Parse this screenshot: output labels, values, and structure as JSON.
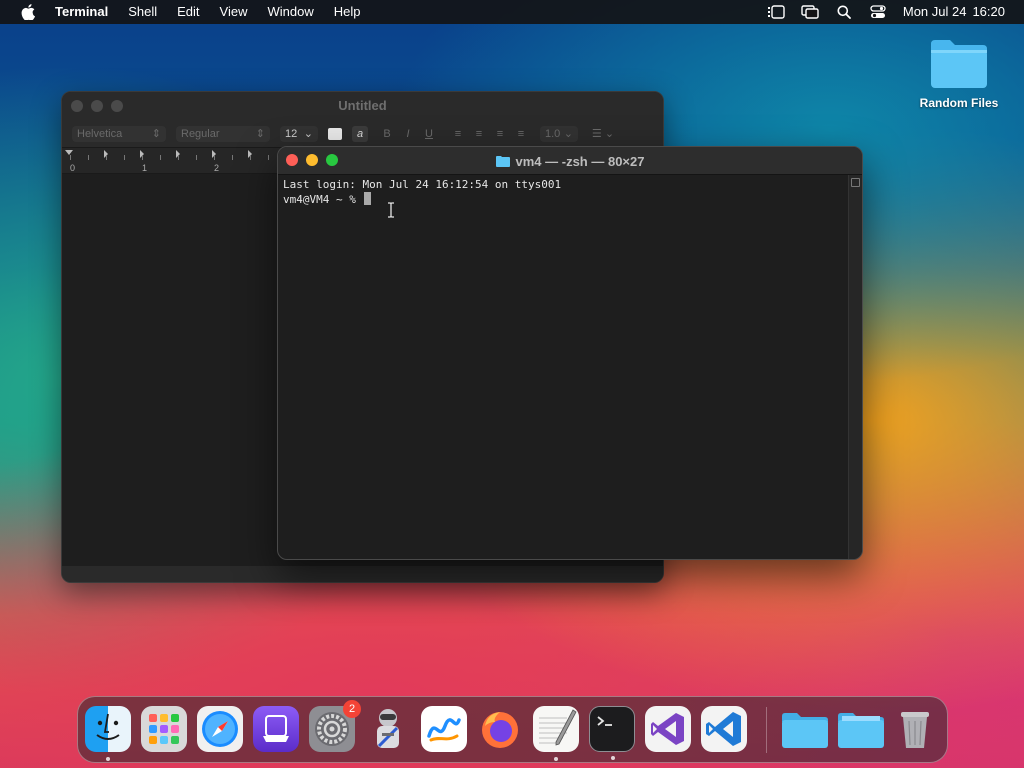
{
  "menubar": {
    "app_name": "Terminal",
    "menus": [
      "Shell",
      "Edit",
      "View",
      "Window",
      "Help"
    ],
    "date": "Mon Jul 24",
    "time": "16:20"
  },
  "desktop": {
    "icons": [
      {
        "label": "Random Files",
        "icon": "folder-icon"
      }
    ]
  },
  "textedit": {
    "title": "Untitled",
    "font_family": "Helvetica",
    "font_style": "Regular",
    "font_size": "12",
    "line_spacing": "1.0",
    "ruler_numbers": [
      "0",
      "1",
      "2"
    ],
    "format_buttons": [
      "B",
      "I",
      "U"
    ]
  },
  "terminal": {
    "title": "vm4 — -zsh — 80×27",
    "lines": [
      "Last login: Mon Jul 24 16:12:54 on ttys001",
      "vm4@VM4 ~ % "
    ]
  },
  "dock": {
    "apps": [
      {
        "name": "Finder",
        "icon": "finder-icon",
        "running": true
      },
      {
        "name": "Launchpad",
        "icon": "launchpad-icon",
        "running": false
      },
      {
        "name": "Safari",
        "icon": "safari-icon",
        "running": false
      },
      {
        "name": "Simulator",
        "icon": "simulator-icon",
        "running": false
      },
      {
        "name": "System Settings",
        "icon": "system-settings-icon",
        "running": false,
        "badge": "2"
      },
      {
        "name": "Automator",
        "icon": "automator-icon",
        "running": false
      },
      {
        "name": "Freeform",
        "icon": "freeform-icon",
        "running": false
      },
      {
        "name": "Firefox",
        "icon": "firefox-icon",
        "running": false
      },
      {
        "name": "TextEdit",
        "icon": "textedit-icon",
        "running": true
      },
      {
        "name": "Terminal",
        "icon": "terminal-icon",
        "running": true
      },
      {
        "name": "Visual Studio",
        "icon": "visual-studio-icon",
        "running": false
      },
      {
        "name": "VS Code",
        "icon": "vscode-icon",
        "running": false
      },
      {
        "name": "Applications",
        "icon": "folder-icon",
        "running": false
      },
      {
        "name": "Downloads",
        "icon": "folder-icon",
        "running": false
      },
      {
        "name": "Trash",
        "icon": "trash-icon",
        "running": false
      }
    ]
  },
  "colors": {
    "terminal_bg": "#1e1e1e",
    "traffic_red": "#fe5f57",
    "traffic_yellow": "#febc2e",
    "traffic_green": "#28c840",
    "badge": "#f44336"
  }
}
